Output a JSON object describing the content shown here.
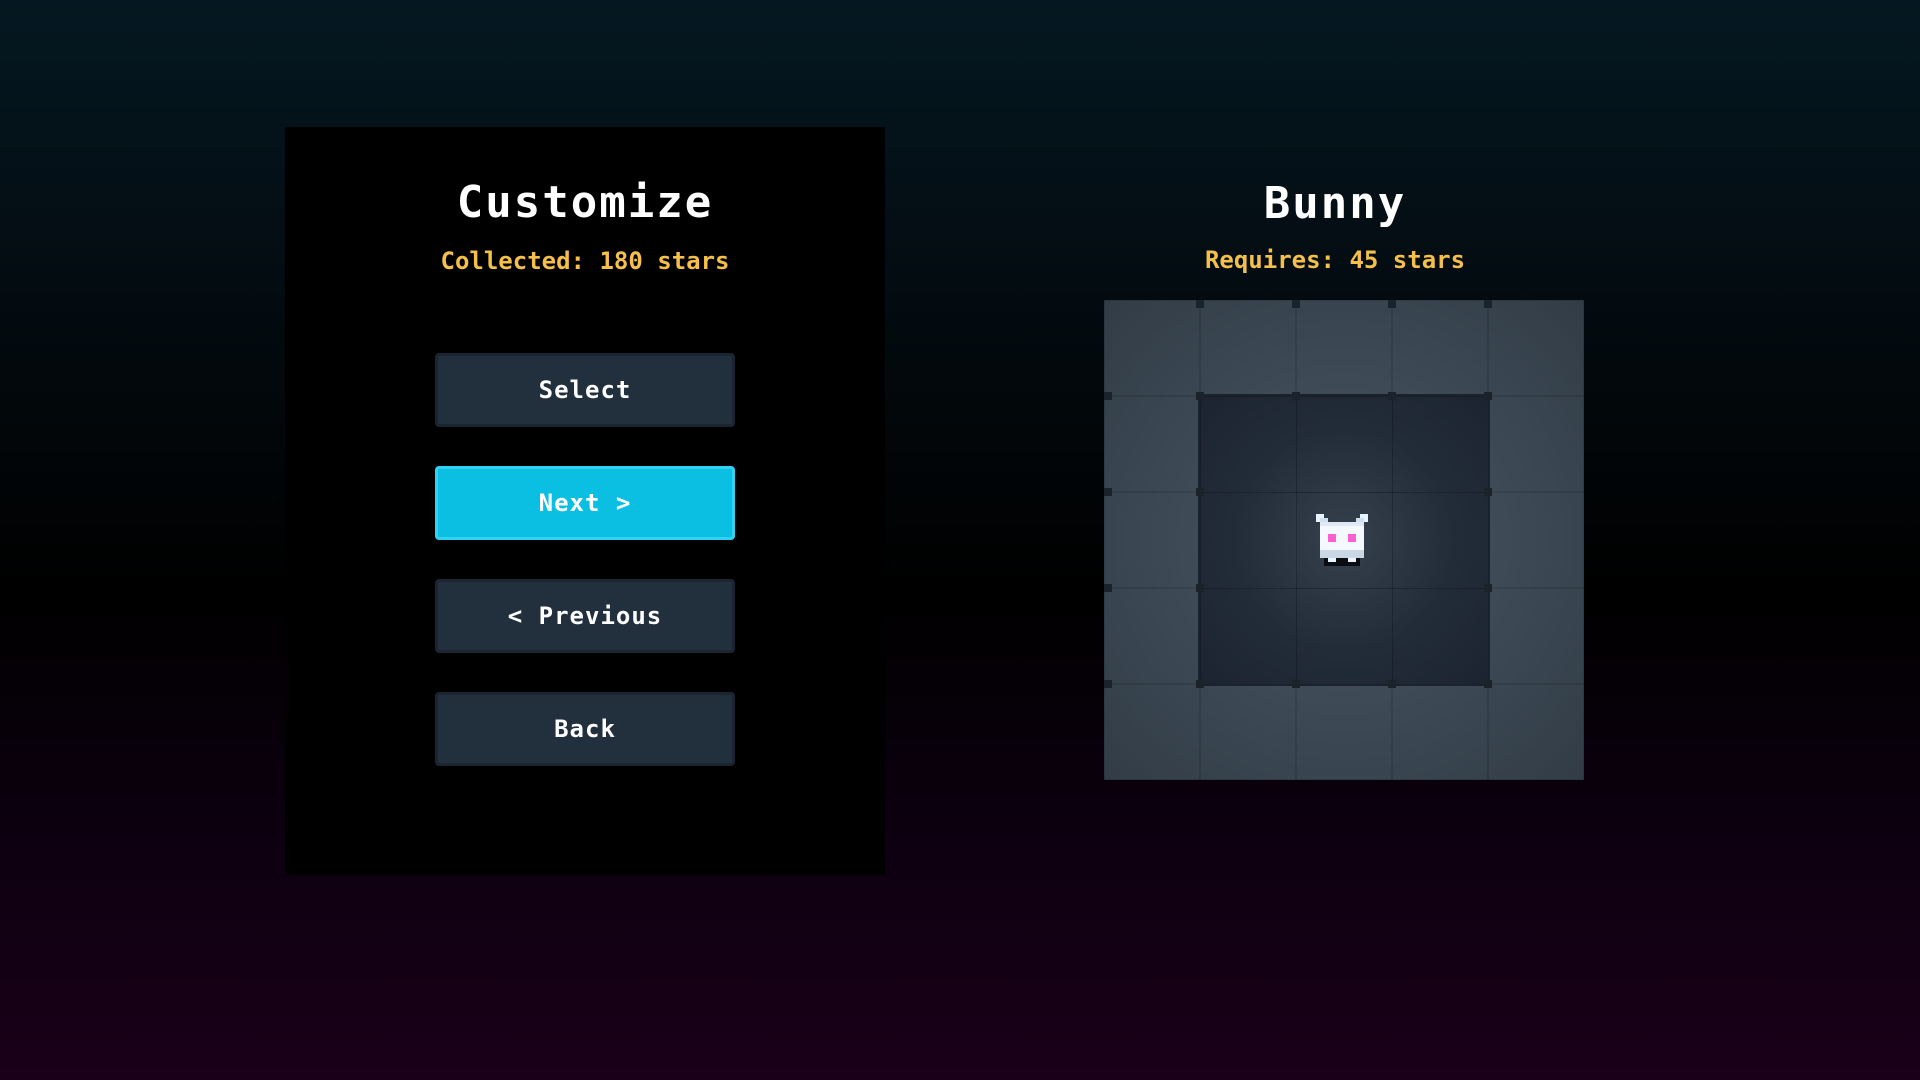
{
  "menu": {
    "title": "Customize",
    "collected": "Collected: 180 stars",
    "buttons": {
      "select": "Select",
      "next": "Next >",
      "previous": "< Previous",
      "back": "Back"
    }
  },
  "preview": {
    "character_name": "Bunny",
    "requires": "Requires: 45 stars",
    "sprite_icon": "bunny-icon"
  },
  "colors": {
    "accent": "#0bbfe3",
    "button": "#222f3d",
    "star_text": "#f5c04a"
  }
}
